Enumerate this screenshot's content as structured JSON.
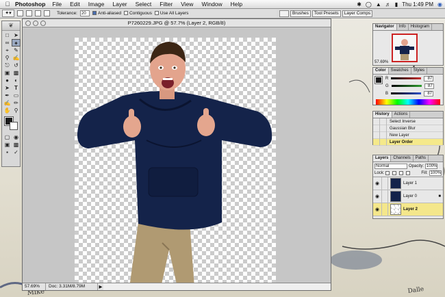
{
  "menubar": {
    "apple_icon": "apple-logo",
    "app_name": "Photoshop",
    "menus": [
      "File",
      "Edit",
      "Image",
      "Layer",
      "Select",
      "Filter",
      "View",
      "Window",
      "Help"
    ],
    "clock": "Thu 1:49 PM"
  },
  "options_bar": {
    "tolerance_label": "Tolerance:",
    "tolerance_value": "20",
    "anti_aliased": "Anti-aliased",
    "contiguous": "Contiguous",
    "use_all_layers": "Use All Layers"
  },
  "well": {
    "tabs": [
      "Brushes",
      "Tool Presets",
      "Layer Comps"
    ]
  },
  "document": {
    "title": "P7260229.JPG @ 57.7% (Layer 2, RGB/8)",
    "zoom": "57.69%",
    "doc_size": "Doc: 3.31M/8.79M"
  },
  "navigator": {
    "tabs": [
      "Navigator",
      "Info",
      "Histogram"
    ],
    "zoom": "57.69%"
  },
  "color_panel": {
    "tabs": [
      "Color",
      "Swatches",
      "Styles"
    ],
    "channels": [
      {
        "label": "R",
        "value": "87",
        "color": "#c83030"
      },
      {
        "label": "G",
        "value": "87",
        "color": "#30a030"
      },
      {
        "label": "B",
        "value": "87",
        "color": "#3050c8"
      }
    ]
  },
  "history": {
    "tabs": [
      "History",
      "Actions"
    ],
    "items": [
      "Select Inverse",
      "Gaussian Blur",
      "New Layer",
      "Layer Order"
    ]
  },
  "layers": {
    "tabs": [
      "Layers",
      "Channels",
      "Paths"
    ],
    "blend_mode": "Normal",
    "opacity_label": "Opacity:",
    "opacity": "100%",
    "lock_label": "Lock:",
    "fill_label": "Fill:",
    "fill": "100%",
    "items": [
      "Layer 1",
      "Layer 0",
      "Layer 2"
    ]
  },
  "colors": {
    "sweater": "#14234a",
    "khakis": "#b09a72",
    "selection_highlight": "#f4e78b"
  }
}
